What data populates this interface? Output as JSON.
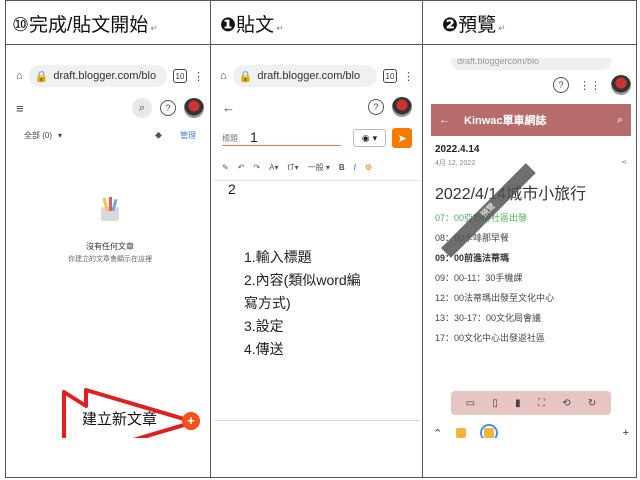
{
  "headers": {
    "col1": "⑩完成/貼文開始",
    "col2_num": "❶",
    "col2": "貼文",
    "col3_num": "❷",
    "col3": "預覽",
    "mark": "↵"
  },
  "panel1": {
    "url": "draft.blogger.com/blo",
    "tabs_count": "10",
    "filter_label": "全部 (0)",
    "manage_label": "管理",
    "empty_title": "沒有任何文章",
    "empty_subtitle": "你建立的文章會顯示在這裡",
    "callout_text": "建立新文章",
    "fab_label": "+"
  },
  "panel2": {
    "url": "draft.blogger.com/blo",
    "title_placeholder": "標題",
    "title_value": "1",
    "format_items": [
      "✎",
      "↶",
      "↷",
      "A▾",
      "tT▾",
      "一般 ▾",
      "B",
      "I",
      "⚙"
    ],
    "body_value": "2",
    "steps": [
      "1.輸入標題",
      "2.內容(類似word編",
      "寫方式)",
      "3.設定",
      "4.傳送"
    ]
  },
  "panel3": {
    "url": "draft.bloggercom/blo",
    "blog_title": "Kinwac單車網誌",
    "post_date": "2022.4.14",
    "post_sub": "4月 12, 2022",
    "post_title": "2022/4/14城市小旅行",
    "schedule": [
      {
        "text": "07：00亞熱帶社區出發",
        "style": "green"
      },
      {
        "text": "08：00卡啡那早餐",
        "style": ""
      },
      {
        "text": "09：00前進法蒂瑪",
        "style": "bold"
      },
      {
        "text": "09：00-11：30手機課",
        "style": ""
      },
      {
        "text": "12：00法蒂瑪出發至文化中心",
        "style": ""
      },
      {
        "text": "13：30-17：00文化局會議",
        "style": ""
      },
      {
        "text": "17：00文化中心出發返社區",
        "style": ""
      }
    ],
    "ribbon_text": "預覽",
    "device_icons": [
      "desktop-icon",
      "tablet-icon",
      "phone-icon",
      "fullscreen-icon",
      "rotate-icon",
      "refresh-icon"
    ]
  },
  "colors": {
    "accent_orange": "#f57c00",
    "fab_red": "#f4511e",
    "blog_header": "#b66c6c",
    "arrow_red": "#e02020"
  }
}
